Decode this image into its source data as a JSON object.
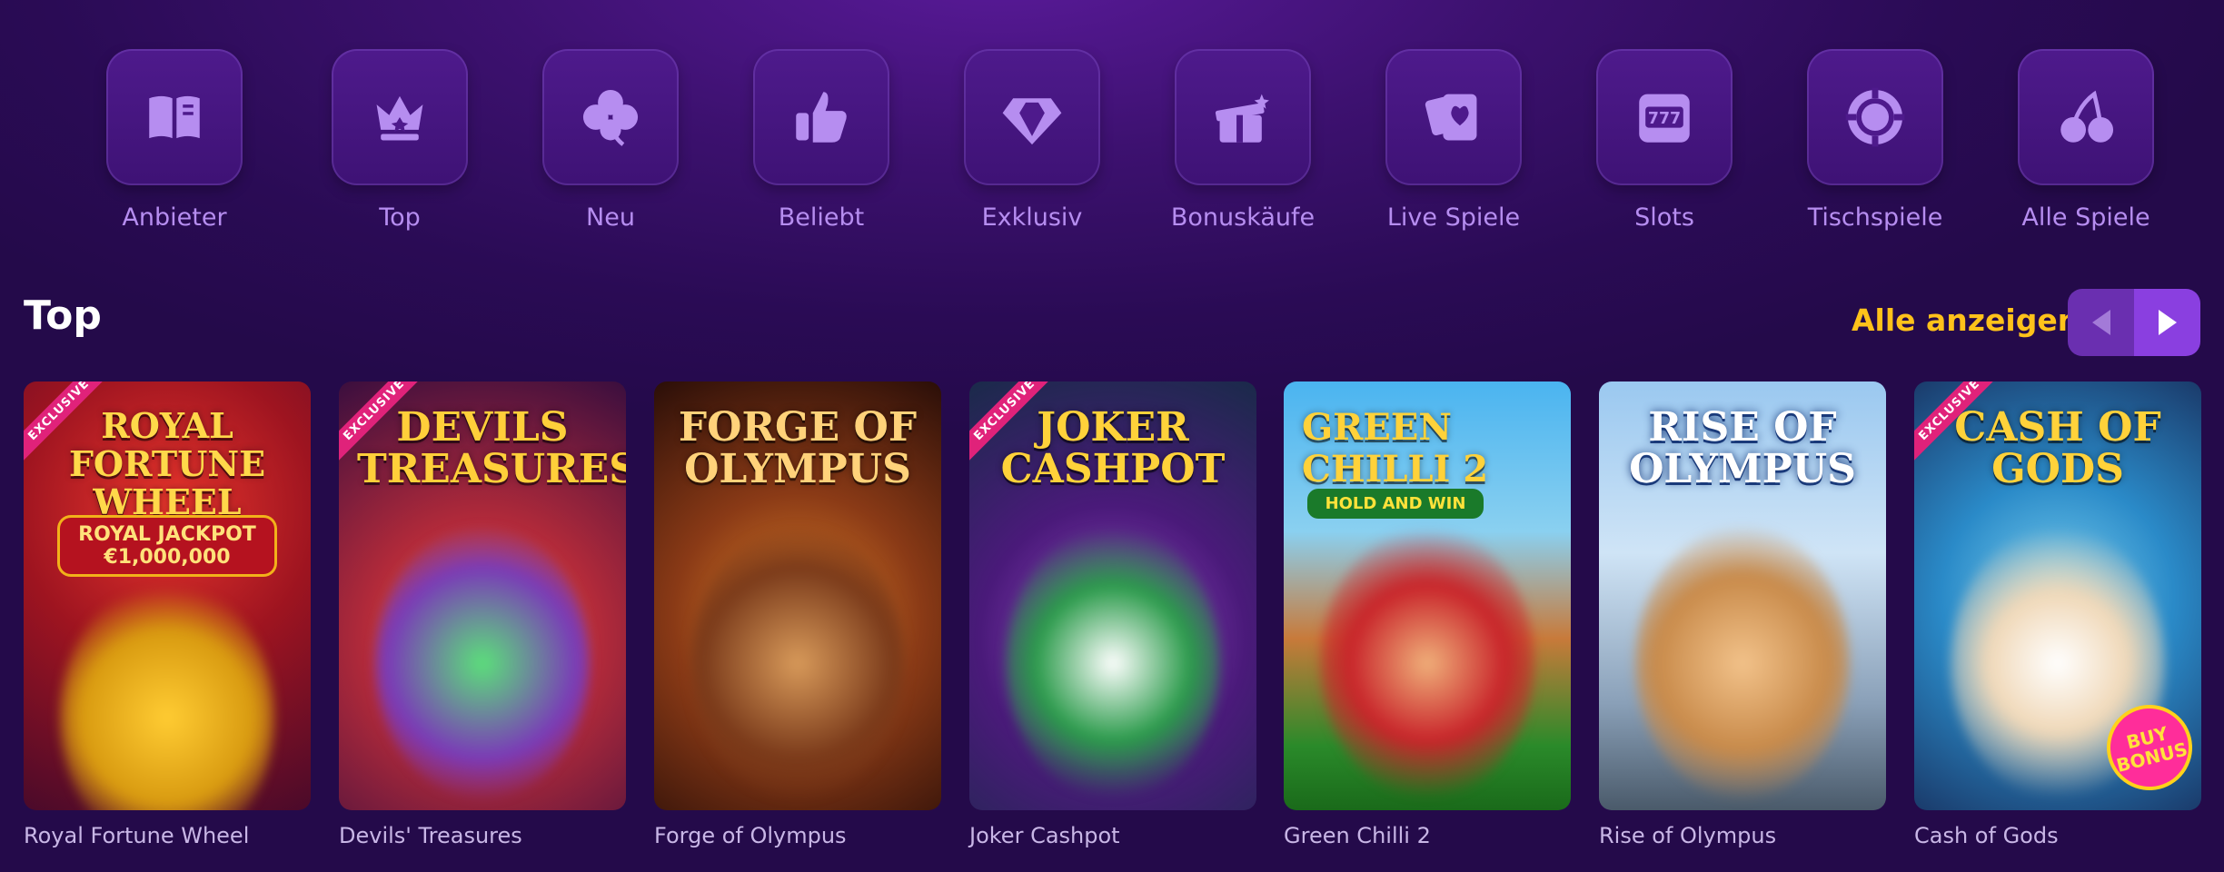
{
  "categories": [
    {
      "label": "Anbieter",
      "icon": "book-icon"
    },
    {
      "label": "Top",
      "icon": "crown-icon"
    },
    {
      "label": "Neu",
      "icon": "clover-icon"
    },
    {
      "label": "Beliebt",
      "icon": "thumbs-up-icon"
    },
    {
      "label": "Exklusiv",
      "icon": "diamond-icon"
    },
    {
      "label": "Bonuskäufe",
      "icon": "gift-icon"
    },
    {
      "label": "Live Spiele",
      "icon": "cards-icon"
    },
    {
      "label": "Slots",
      "icon": "slot-machine-icon"
    },
    {
      "label": "Tischspiele",
      "icon": "poker-chip-icon"
    },
    {
      "label": "Alle Spiele",
      "icon": "cherries-icon"
    }
  ],
  "section": {
    "title": "Top",
    "see_all": "Alle anzeigen"
  },
  "colors": {
    "accent_yellow": "#ffc21a",
    "icon_purple": "#b68df0",
    "exclusive_pink": "#e0227a"
  },
  "games": [
    {
      "name": "Royal Fortune Wheel",
      "logo": "ROYAL FORTUNE WHEEL",
      "sub": "ROYAL JACKPOT €1,000,000",
      "exclusive": "EXCLUSIVE"
    },
    {
      "name": "Devils' Treasures",
      "logo": "DEVILS TREASURES",
      "exclusive": "EXCLUSIVE"
    },
    {
      "name": "Forge of Olympus",
      "logo": "FORGE OF OLYMPUS"
    },
    {
      "name": "Joker Cashpot",
      "logo": "JOKER CASHPOT",
      "exclusive": "EXCLUSIVE"
    },
    {
      "name": "Green Chilli 2",
      "logo": "GREEN CHILLI 2",
      "sub": "HOLD AND WIN"
    },
    {
      "name": "Rise of Olympus",
      "logo": "RISE OF OLYMPUS"
    },
    {
      "name": "Cash of Gods",
      "logo": "CASH OF GODS",
      "exclusive": "EXCLUSIVE",
      "badge": "BUY BONUS"
    }
  ]
}
